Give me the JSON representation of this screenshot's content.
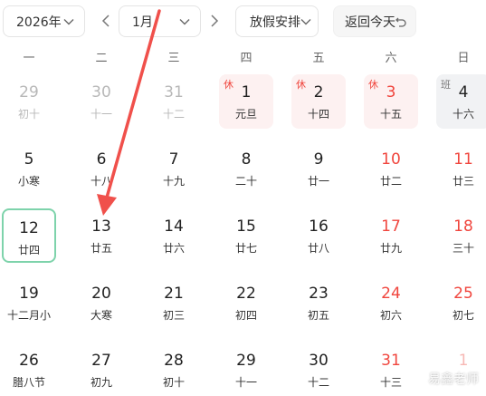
{
  "toolbar": {
    "year": "2026年",
    "month": "1月",
    "holiday_label": "放假安排",
    "today_label": "返回今天"
  },
  "weekdays": [
    "一",
    "二",
    "三",
    "四",
    "五",
    "六",
    "日"
  ],
  "days": [
    {
      "day": "29",
      "lunar": "初十",
      "other": true
    },
    {
      "day": "30",
      "lunar": "十一",
      "other": true
    },
    {
      "day": "31",
      "lunar": "十二",
      "other": true
    },
    {
      "day": "1",
      "lunar": "元旦",
      "tag": "休",
      "holiday": true
    },
    {
      "day": "2",
      "lunar": "十四",
      "tag": "休",
      "holiday": true
    },
    {
      "day": "3",
      "lunar": "十五",
      "tag": "休",
      "holiday": true,
      "weekend": true
    },
    {
      "day": "4",
      "lunar": "十六",
      "tag": "班",
      "workday": true
    },
    {
      "day": "5",
      "lunar": "小寒"
    },
    {
      "day": "6",
      "lunar": "十八"
    },
    {
      "day": "7",
      "lunar": "十九"
    },
    {
      "day": "8",
      "lunar": "二十"
    },
    {
      "day": "9",
      "lunar": "廿一"
    },
    {
      "day": "10",
      "lunar": "廿二",
      "weekend": true
    },
    {
      "day": "11",
      "lunar": "廿三",
      "weekend": true
    },
    {
      "day": "12",
      "lunar": "廿四",
      "selected": true
    },
    {
      "day": "13",
      "lunar": "廿五"
    },
    {
      "day": "14",
      "lunar": "廿六"
    },
    {
      "day": "15",
      "lunar": "廿七"
    },
    {
      "day": "16",
      "lunar": "廿八"
    },
    {
      "day": "17",
      "lunar": "廿九",
      "weekend": true
    },
    {
      "day": "18",
      "lunar": "三十",
      "weekend": true
    },
    {
      "day": "19",
      "lunar": "十二月小"
    },
    {
      "day": "20",
      "lunar": "大寒"
    },
    {
      "day": "21",
      "lunar": "初三"
    },
    {
      "day": "22",
      "lunar": "初四"
    },
    {
      "day": "23",
      "lunar": "初五"
    },
    {
      "day": "24",
      "lunar": "初六",
      "weekend": true
    },
    {
      "day": "25",
      "lunar": "初七",
      "weekend": true
    },
    {
      "day": "26",
      "lunar": "腊八节"
    },
    {
      "day": "27",
      "lunar": "初九"
    },
    {
      "day": "28",
      "lunar": "初十"
    },
    {
      "day": "29",
      "lunar": "十一"
    },
    {
      "day": "30",
      "lunar": "十二"
    },
    {
      "day": "31",
      "lunar": "十三",
      "weekend": true
    },
    {
      "day": "1",
      "lunar": "",
      "weekend": true,
      "other": true
    }
  ],
  "colors": {
    "weekend_red": "#f0453d",
    "holiday_bg": "#fdf1f1",
    "workday_bg": "#f1f2f4",
    "selected_border": "#7ed3ab",
    "annotation_arrow": "#f0504b"
  },
  "watermark": "易鑫老师"
}
